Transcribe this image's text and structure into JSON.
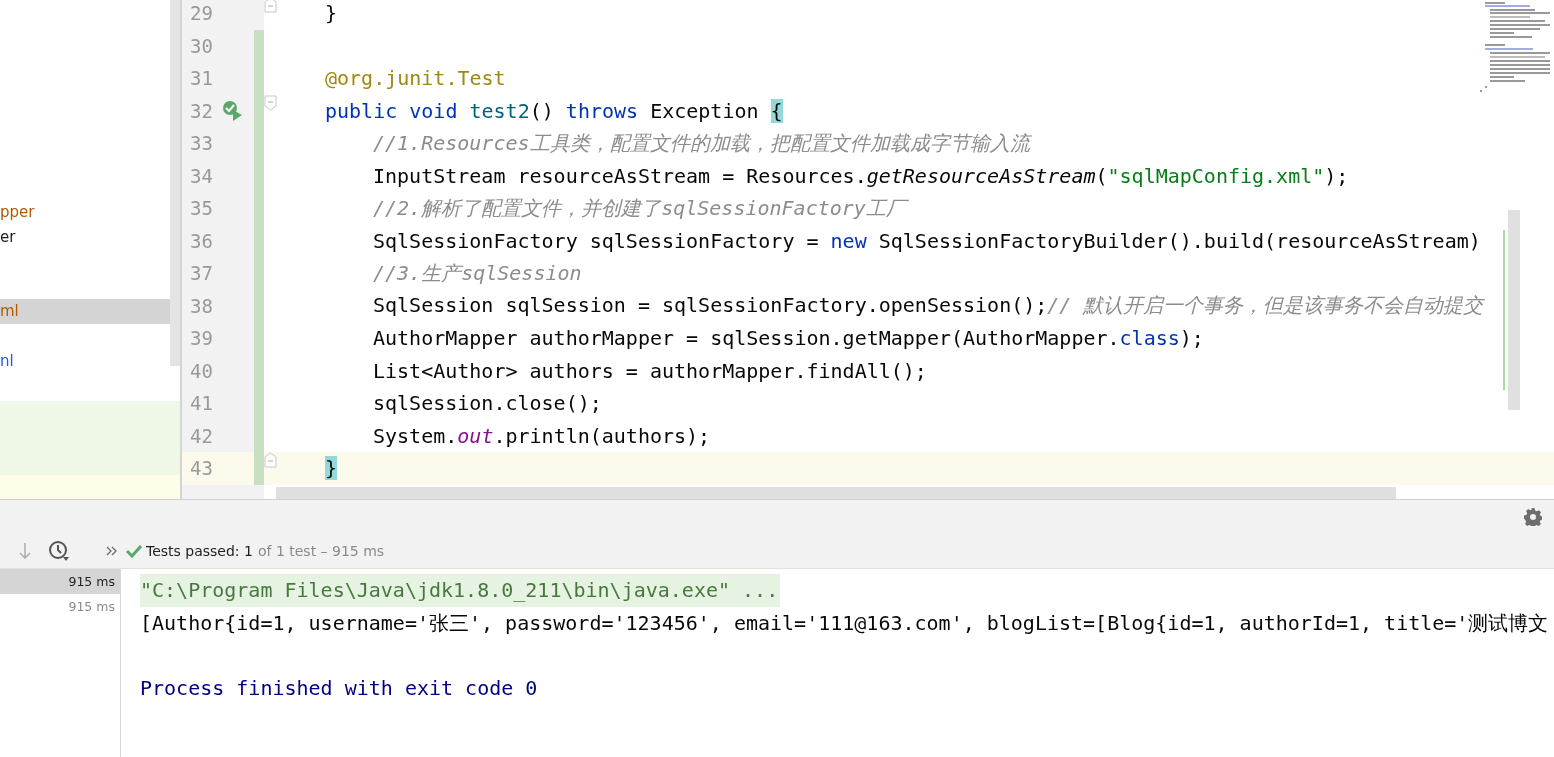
{
  "project_tree": {
    "items": [
      {
        "label": "pper",
        "color": "#b35900",
        "selected": false
      },
      {
        "label": "er",
        "color": "#1f1f1f",
        "selected": false
      },
      {
        "label": "ml",
        "color": "#b35900",
        "selected": true
      },
      {
        "label": "nl",
        "color": "#1f5bd6",
        "selected": false
      }
    ]
  },
  "editor": {
    "lines": [
      {
        "number": "29",
        "changed": false,
        "fold_marker": true,
        "run_icon": false,
        "current": false,
        "tokens": [
          {
            "kind": "plain",
            "text": "}"
          }
        ]
      },
      {
        "number": "30",
        "changed": true,
        "fold_marker": false,
        "run_icon": false,
        "current": false
      },
      {
        "number": "31",
        "changed": true,
        "fold_marker": false,
        "run_icon": false,
        "current": false,
        "tokens": [
          {
            "kind": "annotation",
            "text": "@org.junit.Test"
          }
        ]
      },
      {
        "number": "32",
        "changed": true,
        "fold_marker": true,
        "run_icon": true,
        "current": false,
        "tokens": [
          {
            "kind": "keyword",
            "text": "public void "
          },
          {
            "kind": "declaration",
            "text": "test2"
          },
          {
            "kind": "plain",
            "text": "() "
          },
          {
            "kind": "keyword",
            "text": "throws "
          },
          {
            "kind": "plain",
            "text": "Exception "
          },
          {
            "kind": "brace",
            "text": "{"
          }
        ],
        "children": [
          {
            "number": "33",
            "changed": true,
            "fold_marker": false,
            "run_icon": false,
            "current": false,
            "tokens": [
              {
                "kind": "comment",
                "text": "//1.Resources工具类，配置文件的加载，把配置文件加载成字节输入流"
              }
            ]
          },
          {
            "number": "34",
            "changed": true,
            "fold_marker": false,
            "run_icon": false,
            "current": false,
            "tokens": [
              {
                "kind": "plain",
                "text": "InputStream resourceAsStream = Resources."
              },
              {
                "kind": "static",
                "text": "getResourceAsStream"
              },
              {
                "kind": "plain",
                "text": "("
              },
              {
                "kind": "string",
                "text": "\"sqlMapConfig.xml\""
              },
              {
                "kind": "plain",
                "text": ");"
              }
            ]
          },
          {
            "number": "35",
            "changed": true,
            "fold_marker": false,
            "run_icon": false,
            "current": false,
            "tokens": [
              {
                "kind": "comment",
                "text": "//2.解析了配置文件，并创建了sqlSessionFactory工厂"
              }
            ]
          },
          {
            "number": "36",
            "changed": true,
            "fold_marker": false,
            "run_icon": false,
            "current": false,
            "tokens": [
              {
                "kind": "plain",
                "text": "SqlSessionFactory sqlSessionFactory = "
              },
              {
                "kind": "keyword",
                "text": "new "
              },
              {
                "kind": "plain",
                "text": "SqlSessionFactoryBuilder().build(resourceAsStream)"
              }
            ]
          },
          {
            "number": "37",
            "changed": true,
            "fold_marker": false,
            "run_icon": false,
            "current": false,
            "tokens": [
              {
                "kind": "comment",
                "text": "//3.生产sqlSession"
              }
            ]
          },
          {
            "number": "38",
            "changed": true,
            "fold_marker": false,
            "run_icon": false,
            "current": false,
            "tokens": [
              {
                "kind": "plain",
                "text": "SqlSession sqlSession = sqlSessionFactory.openSession();"
              },
              {
                "kind": "comment",
                "text": "// 默认开启一个事务，但是该事务不会自动提交"
              }
            ]
          },
          {
            "number": "39",
            "changed": true,
            "fold_marker": false,
            "run_icon": false,
            "current": false,
            "tokens": [
              {
                "kind": "plain",
                "text": "AuthorMapper authorMapper = sqlSession.getMapper(AuthorMapper."
              },
              {
                "kind": "keyword",
                "text": "class"
              },
              {
                "kind": "plain",
                "text": ");"
              }
            ]
          },
          {
            "number": "40",
            "changed": true,
            "fold_marker": false,
            "run_icon": false,
            "current": false,
            "tokens": [
              {
                "kind": "plain",
                "text": "List<Author> authors = authorMapper.findAll();"
              }
            ]
          },
          {
            "number": "41",
            "changed": true,
            "fold_marker": false,
            "run_icon": false,
            "current": false,
            "tokens": [
              {
                "kind": "plain",
                "text": "sqlSession.close();"
              }
            ]
          },
          {
            "number": "42",
            "changed": true,
            "fold_marker": false,
            "run_icon": false,
            "current": false,
            "tokens": [
              {
                "kind": "plain",
                "text": "System."
              },
              {
                "kind": "field",
                "text": "out"
              },
              {
                "kind": "plain",
                "text": ".println(authors);"
              }
            ]
          }
        ]
      },
      {
        "number": "43",
        "changed": true,
        "fold_marker": true,
        "run_icon": false,
        "current": true,
        "tokens": [
          {
            "kind": "brace",
            "text": "}"
          }
        ]
      }
    ]
  },
  "test_bar": {
    "summary": "Tests passed: 1",
    "detail": "of 1 test – 915 ms"
  },
  "test_list": [
    {
      "duration": "915 ms",
      "selected": true
    },
    {
      "duration": "915 ms",
      "selected": false
    }
  ],
  "console": {
    "lines": [
      {
        "kind": "command",
        "text": "\"C:\\Program Files\\Java\\jdk1.8.0_211\\bin\\java.exe\" ..."
      },
      {
        "kind": "output",
        "text": "[Author{id=1, username='张三', password='123456', email='111@163.com', blogList=[Blog{id=1, authorId=1, title='测试博文"
      },
      {
        "kind": "exit",
        "text": "Process finished with exit code 0"
      }
    ]
  }
}
